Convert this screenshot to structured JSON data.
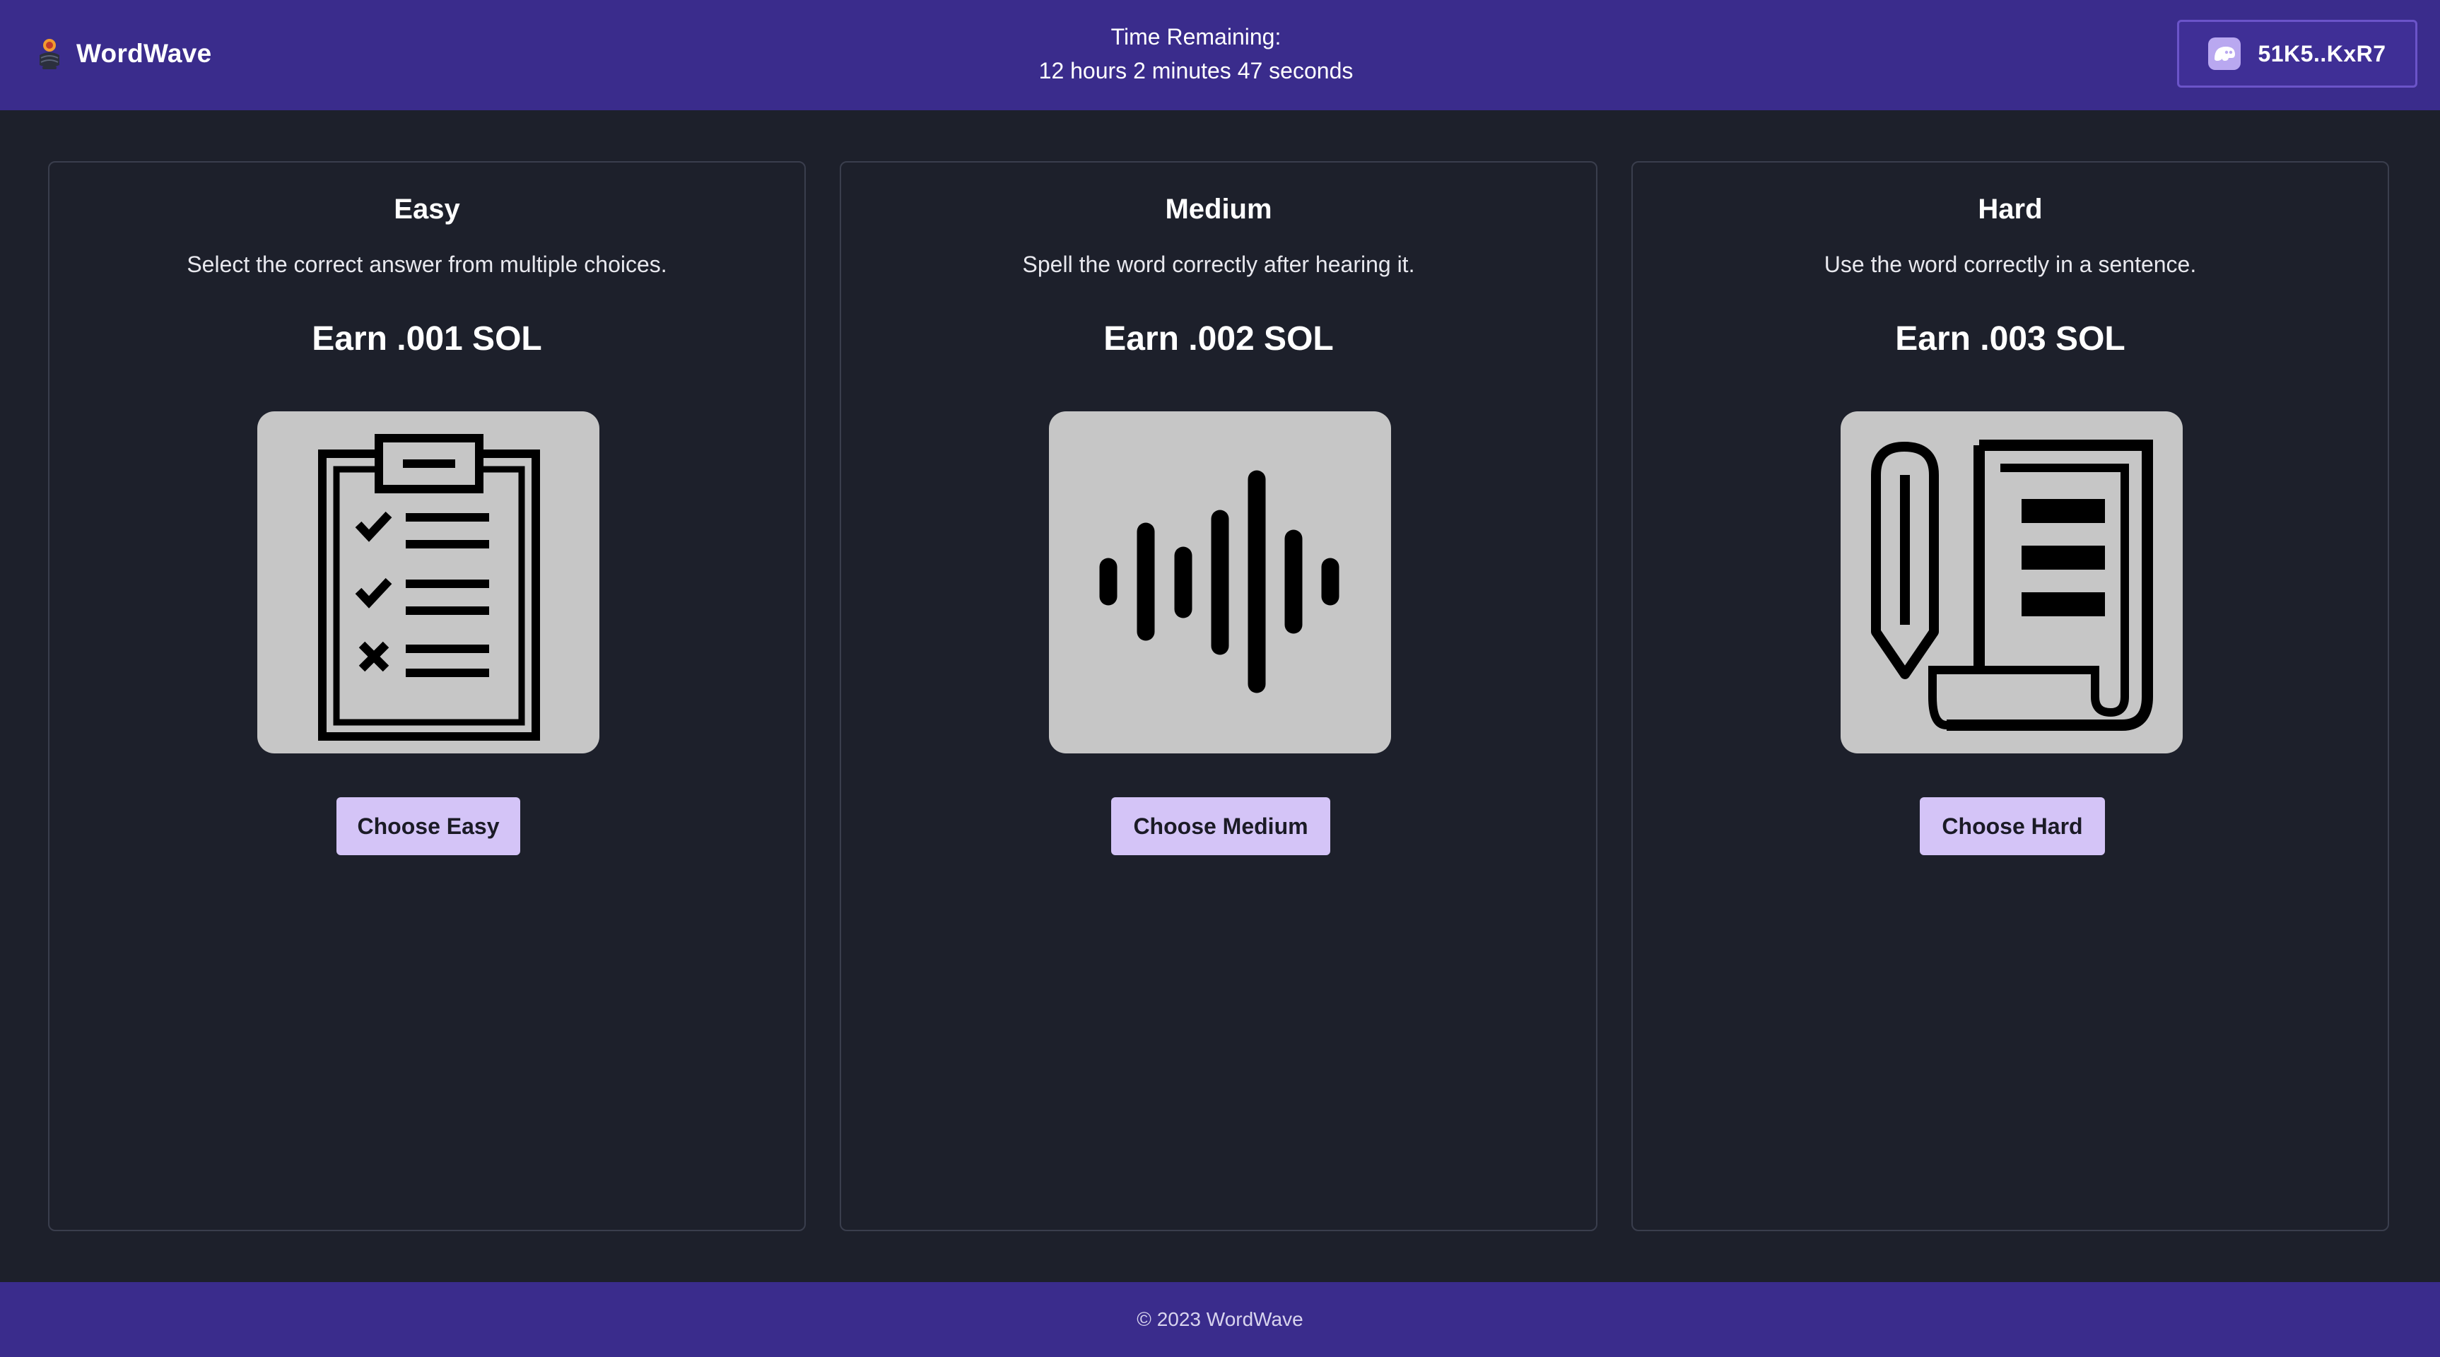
{
  "header": {
    "brand_name": "WordWave",
    "timer_label": "Time Remaining:",
    "timer_value": "12 hours 2 minutes 47 seconds",
    "wallet_label": "51K5..KxR7"
  },
  "levels": [
    {
      "title": "Easy",
      "description": "Select the correct answer from multiple choices.",
      "reward": "Earn .001 SOL",
      "icon": "clipboard-checklist-icon",
      "button_label": "Choose Easy"
    },
    {
      "title": "Medium",
      "description": "Spell the word correctly after hearing it.",
      "reward": "Earn .002 SOL",
      "icon": "sound-wave-icon",
      "button_label": "Choose Medium"
    },
    {
      "title": "Hard",
      "description": "Use the word correctly in a sentence.",
      "reward": "Earn .003 SOL",
      "icon": "pencil-scroll-icon",
      "button_label": "Choose Hard"
    }
  ],
  "footer": {
    "copyright": "© 2023 WordWave"
  },
  "colors": {
    "header_bg": "#3a2c8c",
    "page_bg": "#1d202b",
    "button_bg": "#d4c4f7",
    "icon_tile_bg": "#c6c6c6"
  }
}
